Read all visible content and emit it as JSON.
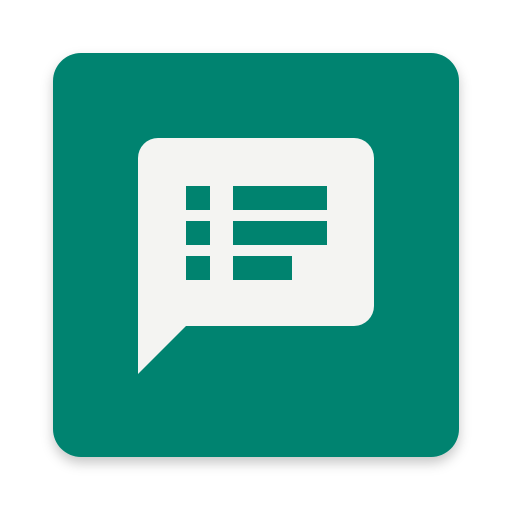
{
  "icon": {
    "name": "feedback-list-icon",
    "colors": {
      "background": "#00836F",
      "bubble": "#F4F4F2",
      "shadow": "#000000"
    }
  }
}
